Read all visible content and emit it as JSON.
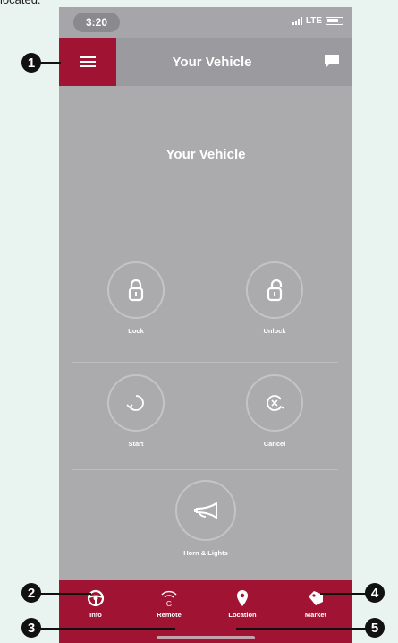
{
  "caption_fragment": "located.",
  "status": {
    "time": "3:20",
    "network": "LTE"
  },
  "navbar": {
    "title": "Your Vehicle"
  },
  "main": {
    "heading": "Your Vehicle"
  },
  "actions": {
    "lock": "Lock",
    "unlock": "Unlock",
    "start": "Start",
    "cancel": "Cancel",
    "horn": "Horn & Lights"
  },
  "tabs": [
    {
      "label": "Info",
      "icon": "steering-wheel-icon"
    },
    {
      "label": "Remote",
      "icon": "remote-signal-icon"
    },
    {
      "label": "Location",
      "icon": "location-pin-icon"
    },
    {
      "label": "Market",
      "icon": "tag-icon"
    }
  ],
  "callouts": [
    "1",
    "2",
    "3",
    "4",
    "5"
  ],
  "colors": {
    "brand": "#a11333",
    "background": "#ababae",
    "navbar": "#9b9b9f"
  }
}
